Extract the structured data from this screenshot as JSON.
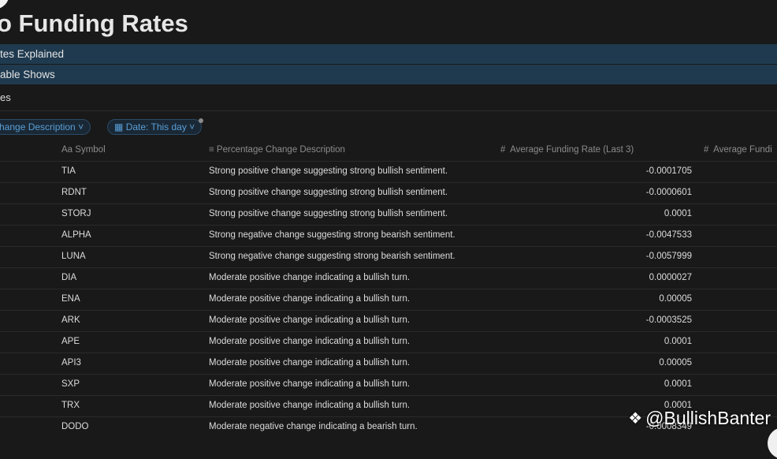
{
  "page": {
    "title": "o Funding Rates"
  },
  "toggles": [
    {
      "label": "tes Explained"
    },
    {
      "label": "able Shows"
    }
  ],
  "section": {
    "label": "es"
  },
  "filters": [
    {
      "label": "hange Description",
      "icon": "chevron-down-icon"
    },
    {
      "label": "Date: This day",
      "icon": "calendar-icon"
    }
  ],
  "table": {
    "columns": [
      {
        "icon": "Aa",
        "label": "Symbol"
      },
      {
        "icon": "text-lines-icon",
        "label": "Percentage Change Description"
      },
      {
        "icon": "#",
        "label": "Average Funding Rate (Last 3)"
      },
      {
        "icon": "#",
        "label": "Average Fundi"
      }
    ],
    "rows": [
      {
        "symbol": "TIA",
        "description": "Strong positive change suggesting strong bullish sentiment.",
        "rate": "-0.0001705"
      },
      {
        "symbol": "RDNT",
        "description": "Strong positive change suggesting strong bullish sentiment.",
        "rate": "-0.0000601"
      },
      {
        "symbol": "STORJ",
        "description": "Strong positive change suggesting strong bullish sentiment.",
        "rate": "0.0001"
      },
      {
        "symbol": "ALPHA",
        "description": "Strong negative change suggesting strong bearish sentiment.",
        "rate": "-0.0047533"
      },
      {
        "symbol": "LUNA",
        "description": "Strong negative change suggesting strong bearish sentiment.",
        "rate": "-0.0057999"
      },
      {
        "symbol": "DIA",
        "description": "Moderate positive change indicating a bullish turn.",
        "rate": "0.0000027"
      },
      {
        "symbol": "ENA",
        "description": "Moderate positive change indicating a bullish turn.",
        "rate": "0.00005"
      },
      {
        "symbol": "ARK",
        "description": "Moderate positive change indicating a bullish turn.",
        "rate": "-0.0003525"
      },
      {
        "symbol": "APE",
        "description": "Moderate positive change indicating a bullish turn.",
        "rate": "0.0001"
      },
      {
        "symbol": "API3",
        "description": "Moderate positive change indicating a bullish turn.",
        "rate": "0.00005"
      },
      {
        "symbol": "SXP",
        "description": "Moderate positive change indicating a bullish turn.",
        "rate": "0.0001"
      },
      {
        "symbol": "TRX",
        "description": "Moderate positive change indicating a bullish turn.",
        "rate": "0.0001"
      },
      {
        "symbol": "DODO",
        "description": "Moderate negative change indicating a bearish turn.",
        "rate": "-0.0008349"
      }
    ]
  },
  "watermark": {
    "text": "@BullishBanter"
  }
}
